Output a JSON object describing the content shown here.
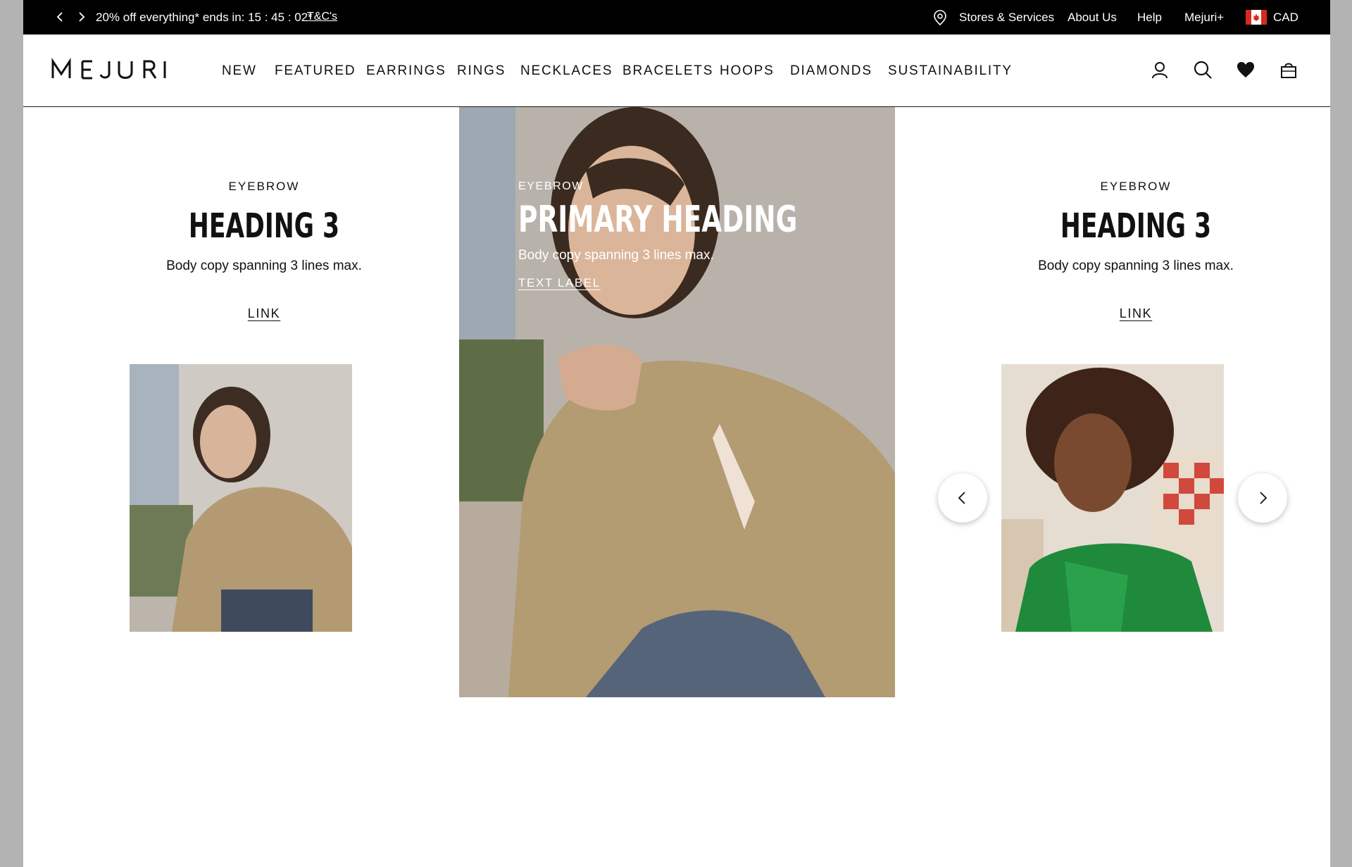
{
  "promo": {
    "text": "20% off everything* ends in: 15 : 45 : 02*",
    "terms_link": "T&C's",
    "stores": "Stores & Services",
    "about": "About Us",
    "help": "Help",
    "plus": "Mejuri+",
    "currency": "CAD"
  },
  "header": {
    "logo": "MEJURI",
    "nav": [
      "NEW",
      "FEATURED",
      "EARRINGS",
      "RINGS",
      "NECKLACES",
      "BRACELETS",
      "HOOPS",
      "DIAMONDS",
      "SUSTAINABILITY"
    ],
    "icons": [
      "account-icon",
      "search-icon",
      "wishlist-heart-icon",
      "bag-icon"
    ]
  },
  "left_card": {
    "eyebrow": "EYEBROW",
    "heading": "HEADING 3",
    "body": "Body copy spanning 3 lines max.",
    "link": "LINK"
  },
  "hero": {
    "eyebrow": "EYEBROW",
    "heading": "PRIMARY HEADING",
    "body": "Body copy spanning 3 lines max.",
    "link": "TEXT LABEL"
  },
  "right_card": {
    "eyebrow": "EYEBROW",
    "heading": "HEADING 3",
    "body": "Body copy spanning 3 lines max.",
    "link": "LINK"
  },
  "colors": {
    "promo_bg": "#000000",
    "text": "#111111",
    "outer_bg": "#b3b3b3"
  }
}
